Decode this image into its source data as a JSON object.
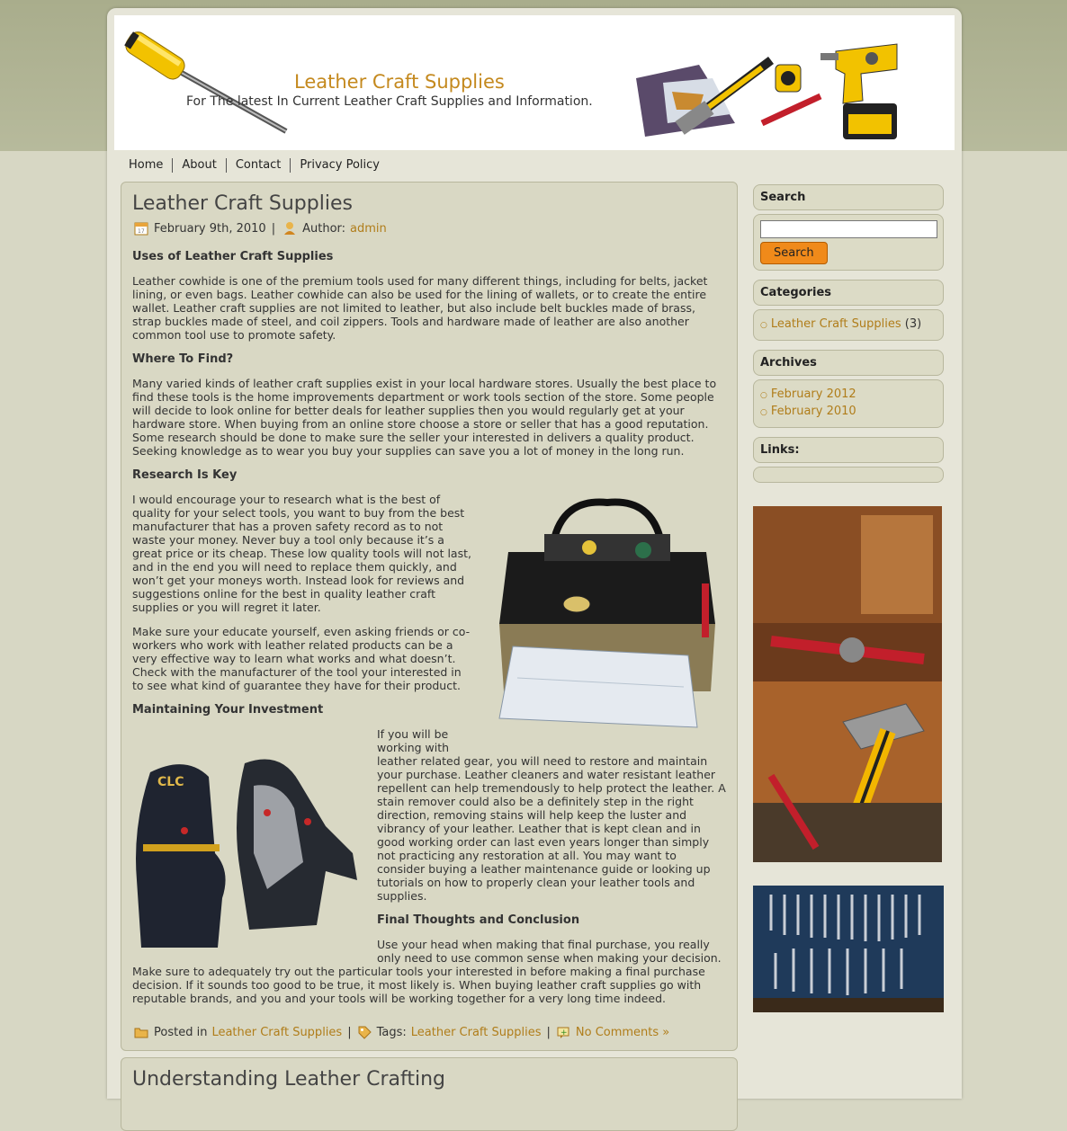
{
  "header": {
    "site_title": "Leather Craft Supplies",
    "site_description": "For The latest In Current Leather Craft Supplies and Information."
  },
  "nav": [
    "Home",
    "About",
    "Contact",
    "Privacy Policy"
  ],
  "post1": {
    "title": "Leather Craft Supplies",
    "date": "February 9th, 2010",
    "author_label": "Author:",
    "author": "admin",
    "sections": [
      {
        "heading": "Uses of Leather Craft Supplies",
        "paragraphs": [
          "Leather cowhide is one of the premium tools used for many different things, including for belts, jacket lining, or even bags. Leather cowhide can also be used for the lining of wallets, or to create the entire wallet. Leather craft supplies are not limited to leather, but also include belt buckles made of brass, strap buckles made of steel, and coil zippers. Tools and hardware made of leather are also another common tool use to promote safety."
        ]
      },
      {
        "heading": "Where To Find?",
        "paragraphs": [
          "Many varied kinds of leather craft supplies exist in your local hardware stores. Usually the best place to find these tools is the home improvements department or work tools section of the store. Some people will decide to look online for better deals for leather supplies then you would regularly get at your hardware store. When buying from an online store choose a store or seller that has a good reputation. Some research should be done to make sure the seller your interested in delivers a quality product. Seeking knowledge as to wear you buy your supplies can save you a lot of money in the long run."
        ]
      },
      {
        "heading": "Research Is Key",
        "paragraphs": [
          "I would encourage your to research what is the best of quality for your select tools, you want to buy from the best manufacturer that has a proven safety record as to not waste your money. Never buy a tool only because it’s a great price or its cheap. These low quality tools will not last, and in the end you will need to replace them quickly, and won’t get your moneys worth. Instead look for reviews and suggestions online for the best in quality leather craft supplies or you will regret it later.",
          "Make sure your educate yourself, even asking friends or co-workers who work with leather related products can be a very effective way to learn what works and what doesn’t. Check with the manufacturer of the tool your interested in to see what kind of guarantee they have for their product."
        ]
      },
      {
        "heading": "Maintaining Your Investment",
        "paragraphs": [
          "If you will be working with leather related gear, you will need to restore and maintain your purchase. Leather cleaners and water resistant leather repellent can help tremendously to help protect the leather. A stain remover could also be a definitely step in the right direction, removing stains will help keep the luster and vibrancy of your leather. Leather that is kept clean and in good working order can last even years longer than simply not practicing any restoration at all. You may want to consider buying a leather maintenance guide or looking up tutorials on how to properly clean your leather tools and supplies."
        ]
      },
      {
        "heading": "Final Thoughts and Conclusion",
        "paragraphs": [
          "Use your head when making that final purchase, you really only need to use common sense when making your decision. Make sure to adequately try out the particular tools your interested in before making a final purchase decision. If it sounds too good to be true, it most likely is. When buying leather craft supplies go with reputable brands, and you and your tools will be working together for a very long time indeed."
        ]
      }
    ],
    "footer": {
      "posted_in_label": "Posted in",
      "category": "Leather Craft Supplies",
      "tags_label": "Tags:",
      "tag": "Leather Craft Supplies",
      "comments": "No Comments »"
    }
  },
  "post2": {
    "title": "Understanding Leather Crafting"
  },
  "sidebar": {
    "search_title": "Search",
    "search_button": "Search",
    "search_value": "",
    "categories_title": "Categories",
    "category_link": "Leather Craft Supplies",
    "category_count": "(3)",
    "archives_title": "Archives",
    "archives": [
      "February 2012",
      "February 2010"
    ],
    "links_title": "Links:"
  },
  "colors": {
    "link": "#b07d1a",
    "title": "#c4891e",
    "button": "#f08a1a"
  }
}
